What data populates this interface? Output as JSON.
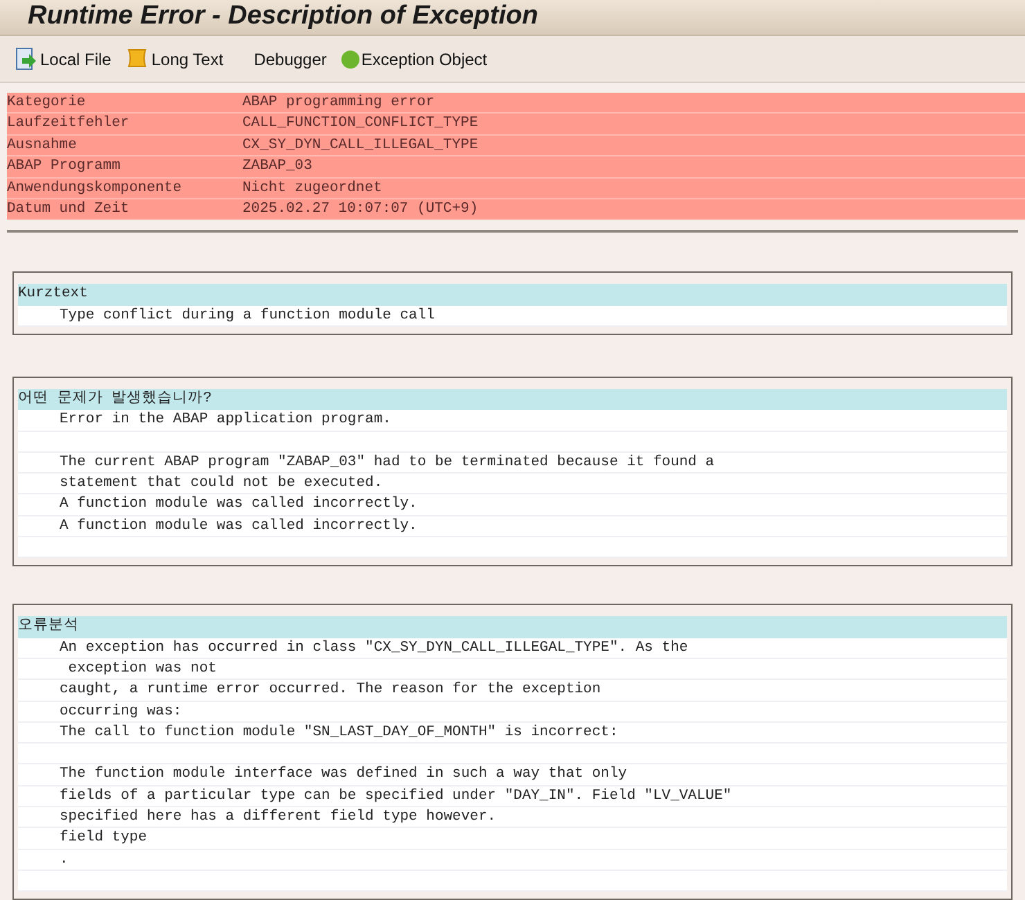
{
  "window": {
    "title": "Runtime Error - Description of Exception"
  },
  "toolbar": [
    {
      "label": "Local File",
      "kind": "file"
    },
    {
      "label": "Long Text",
      "kind": "scroll"
    },
    {
      "label": "Debugger",
      "kind": "plain"
    },
    {
      "label": "Exception Object",
      "kind": "dot"
    }
  ],
  "header_fields": [
    {
      "label": "Kategorie",
      "value": "ABAP programming error"
    },
    {
      "label": "Laufzeitfehler",
      "value": "CALL_FUNCTION_CONFLICT_TYPE"
    },
    {
      "label": "Ausnahme",
      "value": "CX_SY_DYN_CALL_ILLEGAL_TYPE"
    },
    {
      "label": "ABAP Programm",
      "value": "ZABAP_03"
    },
    {
      "label": "Anwendungskomponente",
      "value": "Nicht zugeordnet"
    },
    {
      "label": "Datum und Zeit",
      "value": "2025.02.27 10:07:07 (UTC+9)"
    }
  ],
  "sections": [
    {
      "title": "Kurztext",
      "paragraphs": [
        [
          "Type conflict during a function module call"
        ]
      ]
    },
    {
      "title": "어떤 문제가 발생했습니까?",
      "paragraphs": [
        [
          "Error in the ABAP application program."
        ],
        [
          "The current ABAP program \"ZABAP_03\" had to be terminated because it found a",
          "statement that could not be executed.",
          "A function module was called incorrectly.",
          "A function module was called incorrectly."
        ]
      ]
    },
    {
      "title": "오류분석",
      "paragraphs": [
        [
          "An exception has occurred in class \"CX_SY_DYN_CALL_ILLEGAL_TYPE\". As the",
          " exception was not",
          "caught, a runtime error occurred. The reason for the exception",
          "occurring was:",
          "The call to function module \"SN_LAST_DAY_OF_MONTH\" is incorrect:"
        ],
        [
          "The function module interface was defined in such a way that only",
          "fields of a particular type can be specified under \"DAY_IN\". Field \"LV_VALUE\"",
          "specified here has a different field type however.",
          "field type",
          "."
        ]
      ]
    }
  ]
}
